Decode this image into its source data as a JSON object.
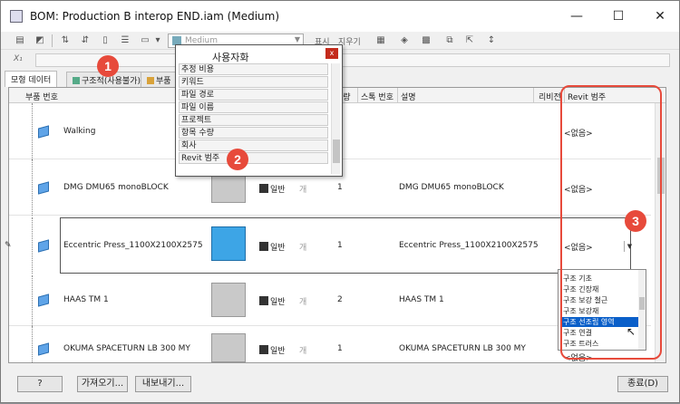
{
  "window": {
    "title": "BOM: Production B interop END.iam (Medium)",
    "minimize": "—",
    "maximize": "☐",
    "close": "✕"
  },
  "toolbar": {
    "combo_value": "Medium",
    "label_show": "표시",
    "label_clear": "지우기"
  },
  "formula": {
    "label": "X₁"
  },
  "tabs": [
    {
      "label": "모형 데이터"
    },
    {
      "label": "구조적(사용불가)"
    },
    {
      "label": "부품"
    }
  ],
  "grid": {
    "headers": {
      "part_number": "부품 번호",
      "qty": "수량",
      "stock": "스톡 번호",
      "desc": "설명",
      "revision": "리비전",
      "revit": "Revit 범주"
    },
    "rows": [
      {
        "name": "Walking",
        "bom": "",
        "unit": "",
        "qty": "",
        "desc": "",
        "revit": "<없음>"
      },
      {
        "name": "DMG DMU65 monoBLOCK",
        "bom": "일반",
        "unit": "개",
        "qty": "1",
        "desc": "DMG DMU65 monoBLOCK",
        "revit": "<없음>"
      },
      {
        "name": "Eccentric Press_1100X2100X2575",
        "bom": "일반",
        "unit": "개",
        "qty": "1",
        "desc": "Eccentric Press_1100X2100X2575",
        "revit": "<없음>"
      },
      {
        "name": "HAAS TM 1",
        "bom": "일반",
        "unit": "개",
        "qty": "2",
        "desc": "HAAS TM 1",
        "revit": ""
      },
      {
        "name": "OKUMA SPACETURN LB 300 MY",
        "bom": "일반",
        "unit": "개",
        "qty": "1",
        "desc": "OKUMA SPACETURN LB 300 MY",
        "revit": "<없음>"
      }
    ]
  },
  "revit_dropdown": {
    "items": [
      "구조 기초",
      "구조 긴장재",
      "구조 보강 철근",
      "구조 보강재",
      "구조 선조립 영역",
      "구조 연결",
      "구조 트러스"
    ],
    "highlighted": "구조 선조립 영역"
  },
  "custom_popup": {
    "title": "사용자화",
    "close": "x",
    "items": [
      "추정 비용",
      "키워드",
      "파일 경로",
      "파일 이름",
      "프로젝트",
      "항목 수량",
      "회사",
      "Revit 범주"
    ]
  },
  "bottom": {
    "help": "?",
    "import": "가져오기...",
    "export": "내보내기...",
    "close": "종료(D)"
  },
  "badges": [
    "1",
    "2",
    "3"
  ],
  "colors": {
    "badge": "#e74a3b",
    "highlight": "#0a5fc9"
  }
}
